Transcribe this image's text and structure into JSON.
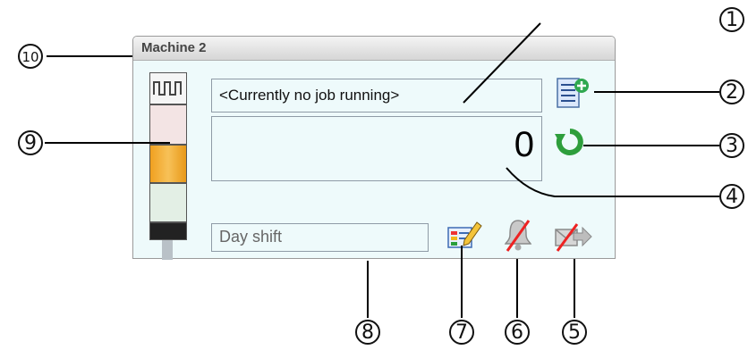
{
  "panel": {
    "title": "Machine 2",
    "job_text": "<Currently no job running>",
    "counter_value": "0",
    "shift_text": "Day shift"
  },
  "callouts": [
    "1",
    "2",
    "3",
    "4",
    "5",
    "6",
    "7",
    "8",
    "9",
    "10"
  ],
  "icons": {
    "job_list": "job-list-add-icon",
    "reset": "reset-counter-icon",
    "edit": "edit-shift-icon",
    "alarm": "alarm-bell-disabled-icon",
    "mail": "mail-forward-disabled-icon",
    "stacklight": "signal-tower"
  },
  "colors": {
    "panel_bg": "#eefafb",
    "light_red": "#f3e4e4",
    "light_orange": "#f0a928",
    "light_green": "#e3efe5"
  }
}
